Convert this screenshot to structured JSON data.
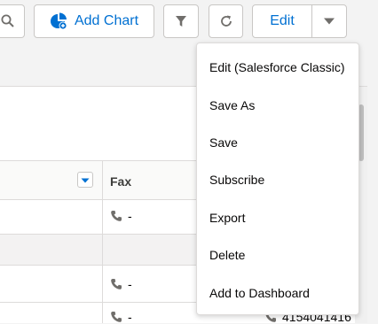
{
  "toolbar": {
    "add_chart_label": "Add Chart",
    "edit_label": "Edit"
  },
  "menu": {
    "items": [
      {
        "label": "Edit (Salesforce Classic)"
      },
      {
        "label": "Save As"
      },
      {
        "label": "Save"
      },
      {
        "label": "Subscribe"
      },
      {
        "label": "Export"
      },
      {
        "label": "Delete"
      },
      {
        "label": "Add to Dashboard"
      }
    ]
  },
  "table": {
    "columns": [
      {
        "label": "Fax"
      }
    ],
    "rows": [
      {
        "fax": "-"
      },
      {
        "fax": ""
      },
      {
        "fax": "-"
      },
      {
        "fax": "-",
        "fax2": "4154041416"
      }
    ]
  },
  "colors": {
    "accent": "#0070d2",
    "border": "#dddbda",
    "background": "#f3f3f3"
  }
}
